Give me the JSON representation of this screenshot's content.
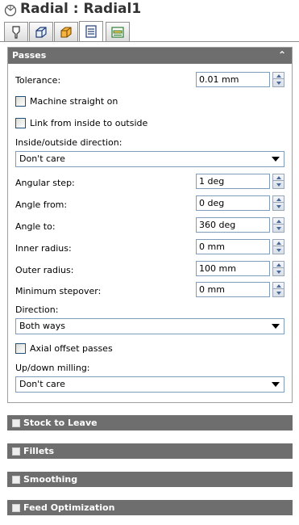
{
  "window": {
    "title": "Radial : Radial1"
  },
  "tabs": [
    {
      "icon": "tool-icon"
    },
    {
      "icon": "model-limits-icon"
    },
    {
      "icon": "stock-icon"
    },
    {
      "icon": "passes-icon"
    },
    {
      "icon": "links-icon"
    }
  ],
  "passes": {
    "header": "Passes",
    "tolerance": {
      "label": "Tolerance:",
      "value": "0.01 mm"
    },
    "machine_straight_on": {
      "label": "Machine straight on",
      "checked": false
    },
    "link_inside_outside": {
      "label": "Link from inside to outside",
      "checked": false
    },
    "inside_outside_direction": {
      "label": "Inside/outside direction:",
      "value": "Don't care"
    },
    "angular_step": {
      "label": "Angular step:",
      "value": "1 deg"
    },
    "angle_from": {
      "label": "Angle from:",
      "value": "0 deg"
    },
    "angle_to": {
      "label": "Angle to:",
      "value": "360 deg"
    },
    "inner_radius": {
      "label": "Inner radius:",
      "value": "0 mm"
    },
    "outer_radius": {
      "label": "Outer radius:",
      "value": "100 mm"
    },
    "minimum_stepover": {
      "label": "Minimum stepover:",
      "value": "0 mm"
    },
    "direction": {
      "label": "Direction:",
      "value": "Both ways"
    },
    "axial_offset_passes": {
      "label": "Axial offset passes",
      "checked": false
    },
    "up_down_milling": {
      "label": "Up/down milling:",
      "value": "Don't care"
    }
  },
  "sections": [
    {
      "label": "Stock to Leave"
    },
    {
      "label": "Fillets"
    },
    {
      "label": "Smoothing"
    },
    {
      "label": "Feed Optimization"
    }
  ],
  "colors": {
    "header_bg": "#6e6e6e",
    "header_text": "#ffffff",
    "spin_arrow": "#4a6a9b"
  }
}
